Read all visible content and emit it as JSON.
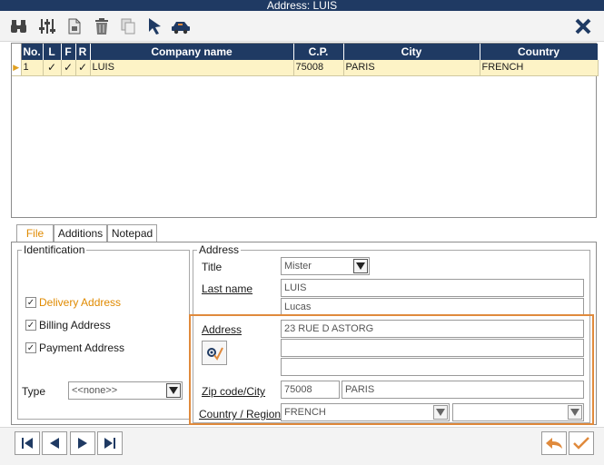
{
  "window": {
    "title": "Address: LUIS"
  },
  "toolbar": {
    "icons": [
      "binoculars-icon",
      "sliders-icon",
      "new-document-icon",
      "trash-icon",
      "copy-icon",
      "pointer-icon",
      "car-icon"
    ],
    "close_icon": "close-icon"
  },
  "grid": {
    "columns": [
      "No.",
      "L",
      "F",
      "R",
      "Company name",
      "C.P.",
      "City",
      "Country"
    ],
    "rows": [
      {
        "no": "1",
        "l": "✓",
        "f": "✓",
        "r": "✓",
        "company": "LUIS",
        "cp": "75008",
        "city": "PARIS",
        "country": "FRENCH"
      }
    ],
    "header_color": "#1f3a63",
    "row_color": "#fdf3c6"
  },
  "tabs": [
    "File",
    "Additions",
    "Notepad"
  ],
  "identification": {
    "legend": "Identification",
    "checkboxes": [
      {
        "label": "Delivery Address",
        "checked": true
      },
      {
        "label": "Billing Address",
        "checked": true
      },
      {
        "label": "Payment Address",
        "checked": true
      }
    ],
    "type_label": "Type",
    "type_value": "<<none>>"
  },
  "address": {
    "legend": "Address",
    "title_label": "Title",
    "title_value": "Mister",
    "lastname_label": "Last name",
    "lastname_value": "LUIS",
    "firstname_value": "Lucas",
    "address_label": "Address",
    "address_line1": "23 RUE D ASTORG",
    "address_line2": "",
    "address_line3": "",
    "zip_label": "Zip code/City",
    "zip_value": "75008",
    "city_value": "PARIS",
    "country_label": "Country / Region",
    "country_value": "FRENCH",
    "region_value": ""
  },
  "accent_color": "#e08a3c"
}
